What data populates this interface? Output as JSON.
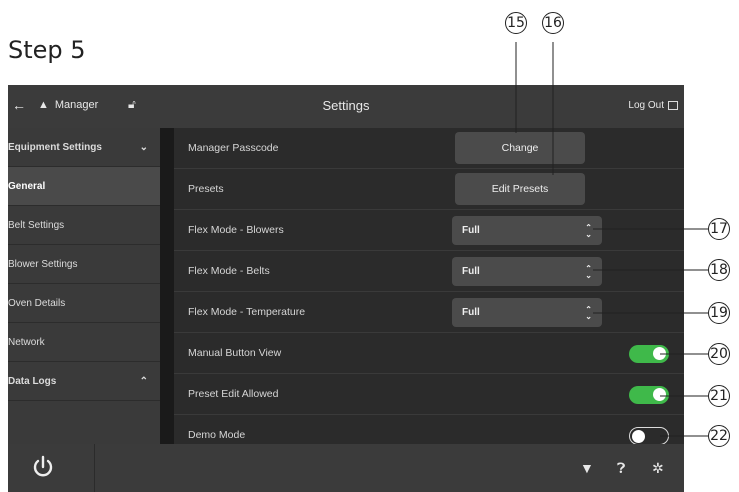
{
  "step_title": "Step 5",
  "topbar": {
    "user_label": "Manager",
    "title": "Settings",
    "logout_label": "Log Out"
  },
  "sidebar": {
    "items": [
      {
        "label": "Equipment Settings",
        "chevron": "v"
      },
      {
        "label": "General"
      },
      {
        "label": "Belt Settings"
      },
      {
        "label": "Blower Settings"
      },
      {
        "label": "Oven Details"
      },
      {
        "label": "Network"
      },
      {
        "label": "Data Logs",
        "chevron": "^"
      }
    ]
  },
  "settings": {
    "rows": [
      {
        "label": "Manager Passcode",
        "button": "Change"
      },
      {
        "label": "Presets",
        "button": "Edit Presets"
      },
      {
        "label": "Flex Mode - Blowers",
        "select": "Full"
      },
      {
        "label": "Flex Mode - Belts",
        "select": "Full"
      },
      {
        "label": "Flex Mode - Temperature",
        "select": "Full"
      },
      {
        "label": "Manual Button View",
        "toggle": true
      },
      {
        "label": "Preset Edit Allowed",
        "toggle": true
      },
      {
        "label": "Demo Mode",
        "toggle": false
      }
    ]
  },
  "callouts": [
    "15",
    "16",
    "17",
    "18",
    "19",
    "20",
    "21",
    "22"
  ],
  "colors": {
    "toggle_on": "#3fb94a",
    "panel_bg": "#2b2b2b"
  }
}
